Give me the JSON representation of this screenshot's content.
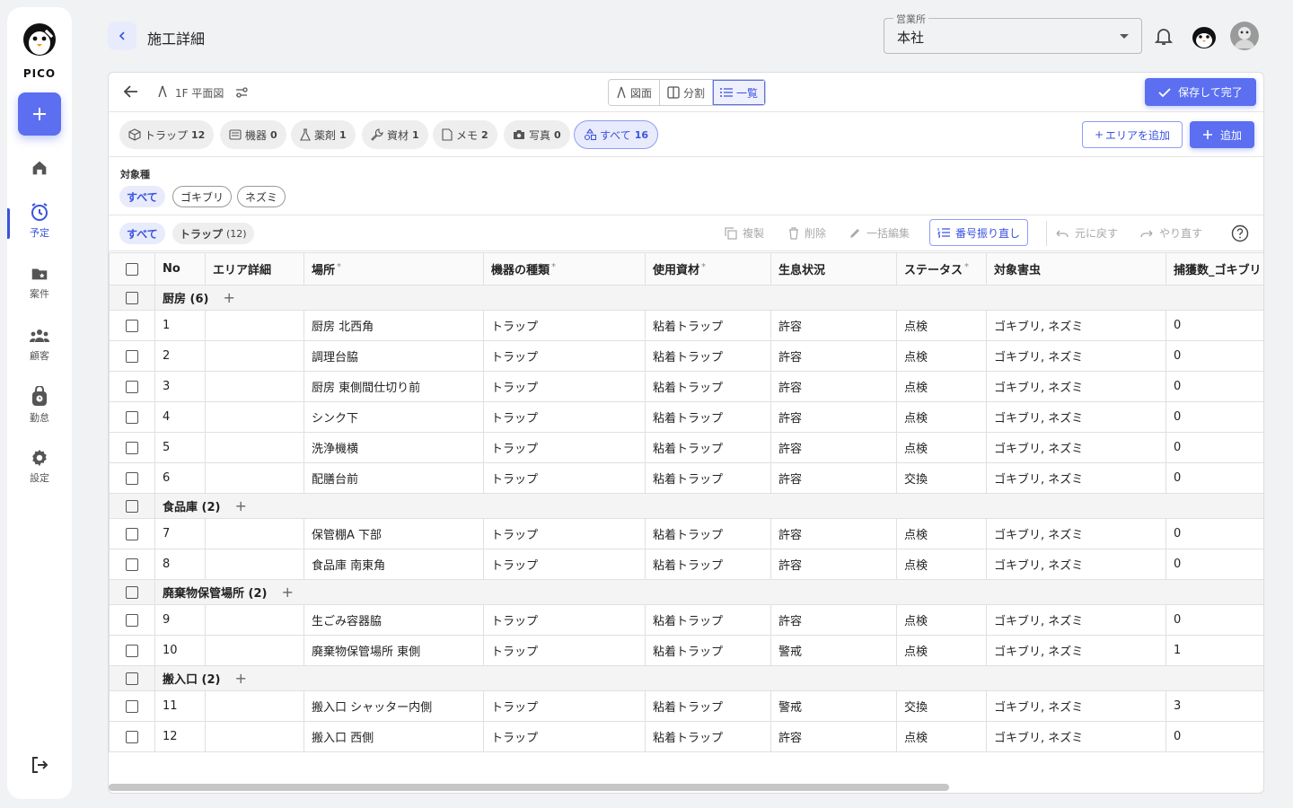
{
  "app": {
    "logo_text": "PICO",
    "page_title": "施工詳細"
  },
  "sidebar": {
    "items": [
      {
        "label": ""
      },
      {
        "label": "予定"
      },
      {
        "label": "案件"
      },
      {
        "label": "顧客"
      },
      {
        "label": "勤怠"
      },
      {
        "label": "設定"
      }
    ]
  },
  "header": {
    "office_label": "営業所",
    "office_value": "本社"
  },
  "toolbar": {
    "floor": "1F 平面図",
    "views": [
      {
        "label": "図面"
      },
      {
        "label": "分割"
      },
      {
        "label": "一覧"
      }
    ],
    "save_label": "保存して完了"
  },
  "chips": [
    {
      "label": "トラップ",
      "count": "12"
    },
    {
      "label": "機器",
      "count": "0"
    },
    {
      "label": "薬剤",
      "count": "1"
    },
    {
      "label": "資材",
      "count": "1"
    },
    {
      "label": "メモ",
      "count": "2"
    },
    {
      "label": "写真",
      "count": "0"
    },
    {
      "label": "すべて",
      "count": "16"
    }
  ],
  "buttons": {
    "add_area": "エリアを追加",
    "add": "追加"
  },
  "target": {
    "label": "対象種",
    "options": [
      "すべて",
      "ゴキブリ",
      "ネズミ"
    ]
  },
  "filter_tabs": [
    {
      "label": "すべて"
    },
    {
      "label": "トラップ",
      "count": "(12)"
    }
  ],
  "actions": {
    "copy": "複製",
    "delete": "削除",
    "bulk_edit": "一括編集",
    "renumber": "番号振り直し",
    "undo": "元に戻す",
    "redo": "やり直す"
  },
  "table": {
    "columns": [
      {
        "label": "No",
        "required": false
      },
      {
        "label": "エリア詳細",
        "required": false
      },
      {
        "label": "場所",
        "required": true
      },
      {
        "label": "機器の種類",
        "required": true
      },
      {
        "label": "使用資材",
        "required": true
      },
      {
        "label": "生息状況",
        "required": false
      },
      {
        "label": "ステータス",
        "required": true
      },
      {
        "label": "対象害虫",
        "required": false
      },
      {
        "label": "捕獲数_ゴキブリ",
        "required": false
      }
    ],
    "groups": [
      {
        "name": "厨房",
        "count": "(6)",
        "rows": [
          [
            "1",
            "",
            "厨房 北西角",
            "トラップ",
            "粘着トラップ",
            "許容",
            "点検",
            "ゴキブリ, ネズミ",
            "0"
          ],
          [
            "2",
            "",
            "調理台脇",
            "トラップ",
            "粘着トラップ",
            "許容",
            "点検",
            "ゴキブリ, ネズミ",
            "0"
          ],
          [
            "3",
            "",
            "厨房 東側間仕切り前",
            "トラップ",
            "粘着トラップ",
            "許容",
            "点検",
            "ゴキブリ, ネズミ",
            "0"
          ],
          [
            "4",
            "",
            "シンク下",
            "トラップ",
            "粘着トラップ",
            "許容",
            "点検",
            "ゴキブリ, ネズミ",
            "0"
          ],
          [
            "5",
            "",
            "洗浄機横",
            "トラップ",
            "粘着トラップ",
            "許容",
            "点検",
            "ゴキブリ, ネズミ",
            "0"
          ],
          [
            "6",
            "",
            "配膳台前",
            "トラップ",
            "粘着トラップ",
            "許容",
            "交換",
            "ゴキブリ, ネズミ",
            "0"
          ]
        ]
      },
      {
        "name": "食品庫",
        "count": "(2)",
        "rows": [
          [
            "7",
            "",
            "保管棚A 下部",
            "トラップ",
            "粘着トラップ",
            "許容",
            "点検",
            "ゴキブリ, ネズミ",
            "0"
          ],
          [
            "8",
            "",
            "食品庫 南東角",
            "トラップ",
            "粘着トラップ",
            "許容",
            "点検",
            "ゴキブリ, ネズミ",
            "0"
          ]
        ]
      },
      {
        "name": "廃棄物保管場所",
        "count": "(2)",
        "rows": [
          [
            "9",
            "",
            "生ごみ容器脇",
            "トラップ",
            "粘着トラップ",
            "許容",
            "点検",
            "ゴキブリ, ネズミ",
            "0"
          ],
          [
            "10",
            "",
            "廃棄物保管場所 東側",
            "トラップ",
            "粘着トラップ",
            "警戒",
            "点検",
            "ゴキブリ, ネズミ",
            "1"
          ]
        ]
      },
      {
        "name": "搬入口",
        "count": "(2)",
        "rows": [
          [
            "11",
            "",
            "搬入口 シャッター内側",
            "トラップ",
            "粘着トラップ",
            "警戒",
            "交換",
            "ゴキブリ, ネズミ",
            "3"
          ],
          [
            "12",
            "",
            "搬入口 西側",
            "トラップ",
            "粘着トラップ",
            "許容",
            "点検",
            "ゴキブリ, ネズミ",
            "0"
          ]
        ]
      }
    ]
  },
  "colors": {
    "accent": "#5b6ff0",
    "accent_text": "#3a52e0"
  }
}
